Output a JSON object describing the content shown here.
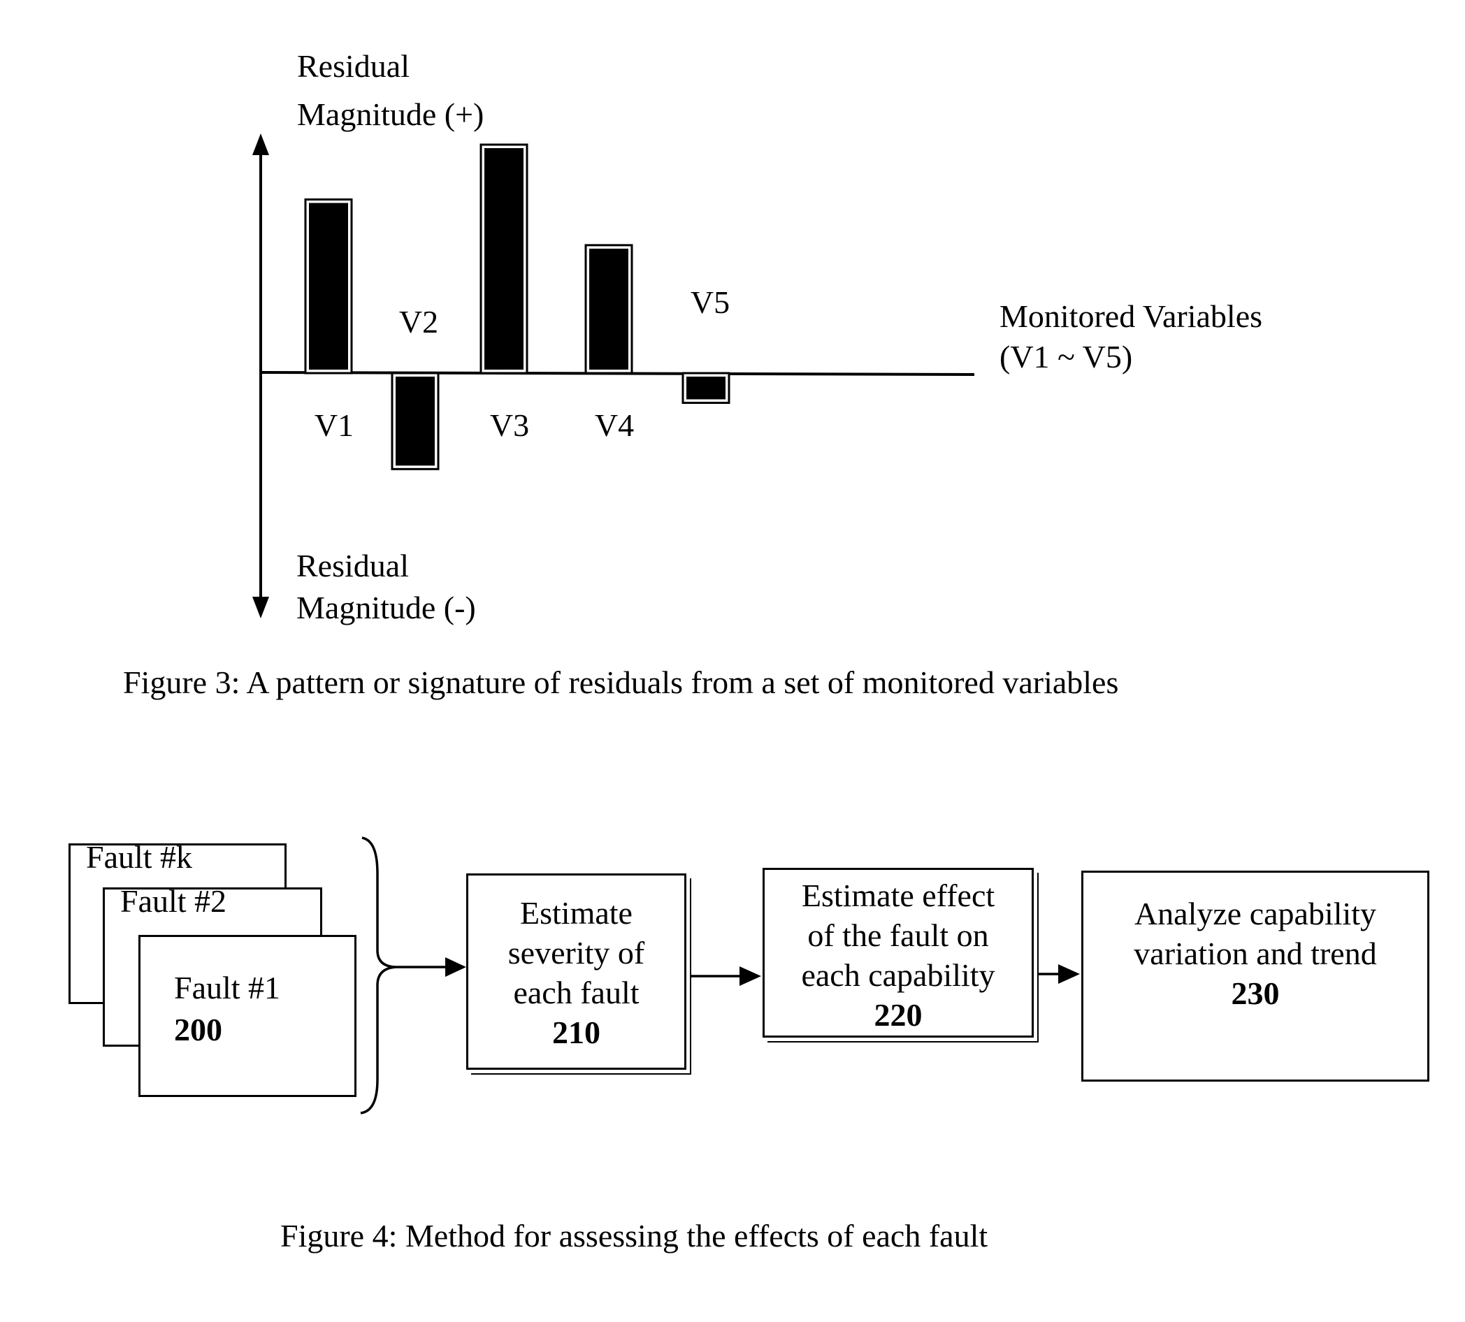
{
  "figure3": {
    "caption": "Figure 3: A pattern or signature of residuals from a set of monitored variables",
    "y_axis_positive_label": [
      "Residual",
      "Magnitude (+)"
    ],
    "y_axis_negative_label": [
      "Residual",
      "Magnitude (-)"
    ],
    "x_axis_label": [
      "Monitored Variables",
      "(V1 ~ V5)"
    ]
  },
  "chart_data": {
    "type": "bar",
    "title": "Figure 3: A pattern or signature of residuals from a set of monitored variables",
    "categories": [
      "V1",
      "V2",
      "V3",
      "V4",
      "V5"
    ],
    "values": [
      76,
      -42,
      100,
      56,
      -13
    ],
    "value_units": "relative residual magnitude (schematic, V3 = 100)",
    "xlabel": "Monitored Variables (V1 ~ V5)",
    "ylabel_positive": "Residual Magnitude (+)",
    "ylabel_negative": "Residual Magnitude (-)",
    "ylim": [
      -195,
      140
    ],
    "grid": false,
    "legend": "none"
  },
  "figure4": {
    "caption": "Figure 4: Method for assessing the effects of each fault",
    "fault_stack": [
      {
        "label": "Fault #k"
      },
      {
        "label": "Fault #2"
      },
      {
        "label": "Fault #1",
        "ref": "200"
      }
    ],
    "steps": [
      {
        "lines": [
          "Estimate",
          "severity of",
          "each fault"
        ],
        "ref": "210"
      },
      {
        "lines": [
          "Estimate effect",
          "of the fault on",
          "each capability"
        ],
        "ref": "220"
      },
      {
        "lines": [
          "Analyze capability",
          "variation and trend"
        ],
        "ref": "230"
      }
    ]
  }
}
